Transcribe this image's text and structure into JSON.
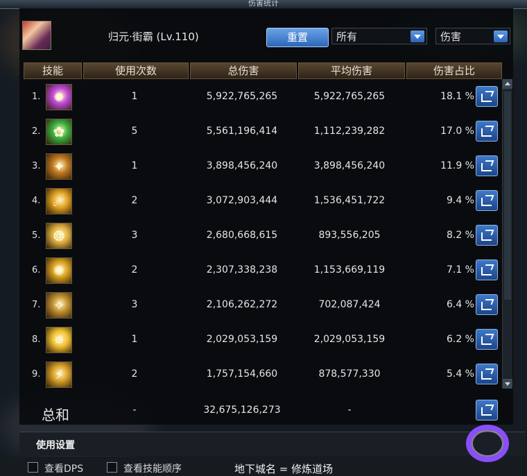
{
  "window": {
    "title": "伤害统计"
  },
  "player": {
    "name": "归元·街霸 (Lv.110)"
  },
  "toolbar": {
    "reset_label": "重置",
    "filter_select": "所有",
    "metric_select": "伤害"
  },
  "table": {
    "headers": [
      "技能",
      "使用次数",
      "总伤害",
      "平均伤害",
      "伤害占比"
    ],
    "rows": [
      {
        "index": "1.",
        "uses": "1",
        "total": "5,922,765,265",
        "avg": "5,922,765,265",
        "pct": "18.1 %"
      },
      {
        "index": "2.",
        "uses": "5",
        "total": "5,561,196,414",
        "avg": "1,112,239,282",
        "pct": "17.0 %"
      },
      {
        "index": "3.",
        "uses": "1",
        "total": "3,898,456,240",
        "avg": "3,898,456,240",
        "pct": "11.9 %"
      },
      {
        "index": "4.",
        "uses": "2",
        "total": "3,072,903,444",
        "avg": "1,536,451,722",
        "pct": "9.4 %"
      },
      {
        "index": "5.",
        "uses": "3",
        "total": "2,680,668,615",
        "avg": "893,556,205",
        "pct": "8.2 %"
      },
      {
        "index": "6.",
        "uses": "2",
        "total": "2,307,338,238",
        "avg": "1,153,669,119",
        "pct": "7.1 %"
      },
      {
        "index": "7.",
        "uses": "3",
        "total": "2,106,262,272",
        "avg": "702,087,424",
        "pct": "6.4 %"
      },
      {
        "index": "8.",
        "uses": "1",
        "total": "2,029,053,159",
        "avg": "2,029,053,159",
        "pct": "6.2 %"
      },
      {
        "index": "9.",
        "uses": "2",
        "total": "1,757,154,660",
        "avg": "878,577,330",
        "pct": "5.4 %"
      }
    ],
    "total_row": {
      "label": "总和",
      "uses": "-",
      "total": "32,675,126,273",
      "avg": "-"
    }
  },
  "settings": {
    "label": "使用设置"
  },
  "footer": {
    "checkbox_dps": "查看DPS",
    "checkbox_skill_order": "查看技能顺序",
    "dungeon_label": "地下城名 = 修炼道场"
  },
  "icons": {
    "skill_colors": [
      "#c048d8",
      "#3cb040",
      "#c07820",
      "#e0a020",
      "#e0b040",
      "#d8a020",
      "#c09030",
      "#f0c030",
      "#d8a028"
    ],
    "share": "share-icon",
    "logo": "logo-icon"
  }
}
